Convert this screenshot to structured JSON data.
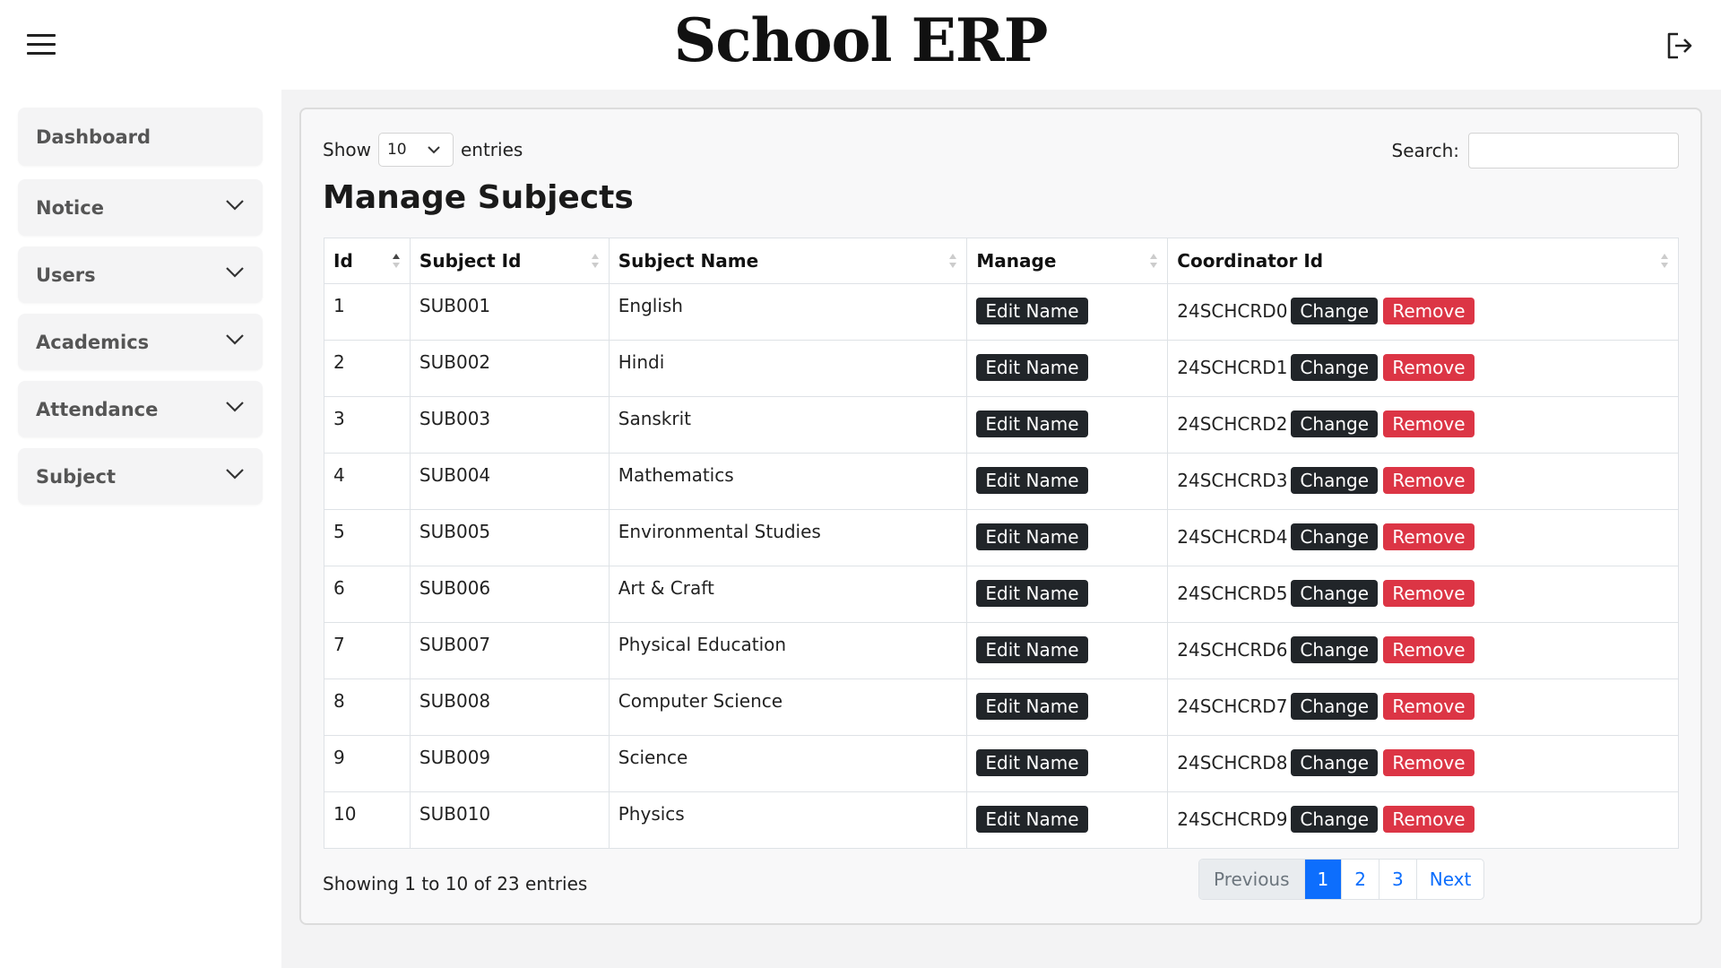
{
  "app": {
    "title": "School ERP"
  },
  "sidebar": {
    "items": [
      {
        "label": "Dashboard",
        "expandable": false
      },
      {
        "label": "Notice",
        "expandable": true
      },
      {
        "label": "Users",
        "expandable": true
      },
      {
        "label": "Academics",
        "expandable": true
      },
      {
        "label": "Attendance",
        "expandable": true
      },
      {
        "label": "Subject",
        "expandable": true
      }
    ]
  },
  "controls": {
    "show_label": "Show",
    "entries_label": "entries",
    "page_length": "10",
    "search_label": "Search:",
    "search_value": ""
  },
  "page_title": "Manage Subjects",
  "table": {
    "columns": [
      "Id",
      "Subject Id",
      "Subject Name",
      "Manage",
      "Coordinator Id"
    ],
    "edit_label": "Edit Name",
    "change_label": "Change",
    "remove_label": "Remove",
    "rows": [
      {
        "id": "1",
        "subject_id": "SUB001",
        "subject_name": "English",
        "coordinator_id": "24SCHCRD0"
      },
      {
        "id": "2",
        "subject_id": "SUB002",
        "subject_name": "Hindi",
        "coordinator_id": "24SCHCRD1"
      },
      {
        "id": "3",
        "subject_id": "SUB003",
        "subject_name": "Sanskrit",
        "coordinator_id": "24SCHCRD2"
      },
      {
        "id": "4",
        "subject_id": "SUB004",
        "subject_name": "Mathematics",
        "coordinator_id": "24SCHCRD3"
      },
      {
        "id": "5",
        "subject_id": "SUB005",
        "subject_name": "Environmental Studies",
        "coordinator_id": "24SCHCRD4"
      },
      {
        "id": "6",
        "subject_id": "SUB006",
        "subject_name": "Art & Craft",
        "coordinator_id": "24SCHCRD5"
      },
      {
        "id": "7",
        "subject_id": "SUB007",
        "subject_name": "Physical Education",
        "coordinator_id": "24SCHCRD6"
      },
      {
        "id": "8",
        "subject_id": "SUB008",
        "subject_name": "Computer Science",
        "coordinator_id": "24SCHCRD7"
      },
      {
        "id": "9",
        "subject_id": "SUB009",
        "subject_name": "Science",
        "coordinator_id": "24SCHCRD8"
      },
      {
        "id": "10",
        "subject_id": "SUB010",
        "subject_name": "Physics",
        "coordinator_id": "24SCHCRD9"
      }
    ]
  },
  "footer": {
    "info": "Showing 1 to 10 of 23 entries",
    "pagination": {
      "previous": "Previous",
      "pages": [
        "1",
        "2",
        "3"
      ],
      "active_page": "1",
      "next": "Next"
    }
  },
  "colors": {
    "primary": "#0d6efd",
    "danger": "#dc3545",
    "dark": "#212529"
  },
  "icons": {
    "menu": "hamburger-menu-icon",
    "logout": "logout-icon",
    "expand": "chevron-down-icon",
    "sort": "sort-icon"
  }
}
